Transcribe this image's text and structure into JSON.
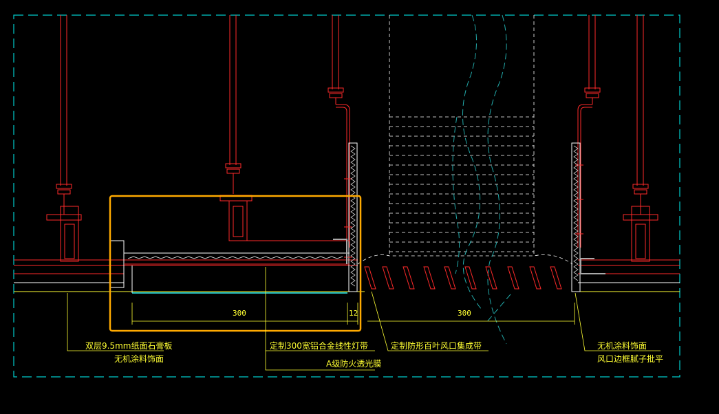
{
  "dimensions": {
    "left_width": "300",
    "left_gap": "12",
    "right_width": "300"
  },
  "annotations": {
    "gypsum_line1": "双层9.5mm纸面石膏板",
    "gypsum_line2": "无机涂料饰面",
    "light_strip_line1": "定制300宽铝合金线性灯带",
    "light_strip_line2": "A级防火透光膜",
    "louver": "定制防形百叶风口集成带",
    "right_line1": "无机涂料饰面",
    "right_line2": "风口边框腻子批平"
  },
  "colors": {
    "background": "#000000",
    "frame": "#00cccc",
    "structure": "#ff2a2a",
    "leader": "#ffff33",
    "highlight": "#ffaa00",
    "hatch": "#cccccc",
    "airflow": "#22aaaa"
  }
}
